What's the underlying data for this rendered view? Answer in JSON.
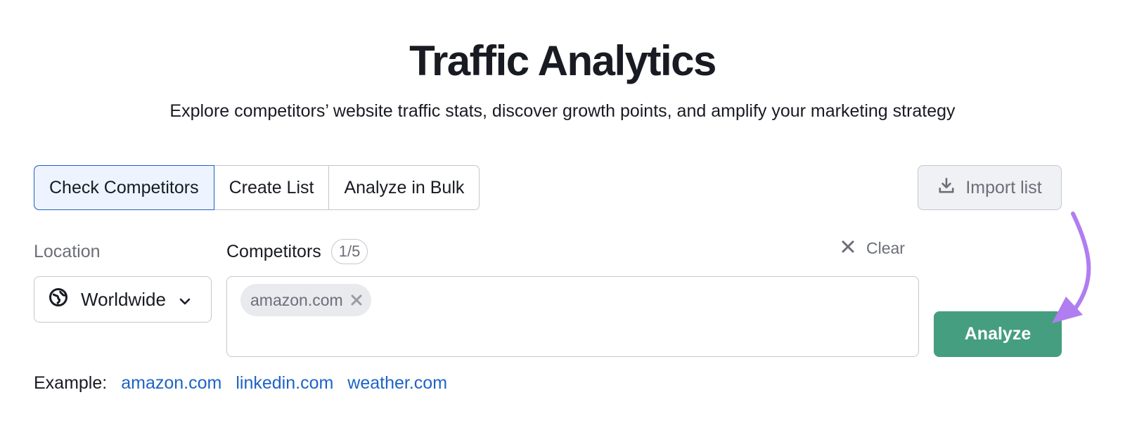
{
  "header": {
    "title": "Traffic Analytics",
    "subtitle": "Explore competitors’ website traffic stats, discover growth points, and amplify your marketing strategy"
  },
  "tabs": [
    {
      "label": "Check Competitors",
      "active": true
    },
    {
      "label": "Create List",
      "active": false
    },
    {
      "label": "Analyze in Bulk",
      "active": false
    }
  ],
  "import_button": {
    "label": "Import list",
    "icon": "download-icon"
  },
  "location": {
    "label": "Location",
    "selected": "Worldwide",
    "icon": "globe-icon"
  },
  "competitors": {
    "label": "Competitors",
    "count": "1/5",
    "clear_label": "Clear",
    "chips": [
      "amazon.com"
    ]
  },
  "analyze_button": {
    "label": "Analyze"
  },
  "examples": {
    "label": "Example:",
    "links": [
      "amazon.com",
      "linkedin.com",
      "weather.com"
    ]
  },
  "colors": {
    "accent_blue": "#1f63c6",
    "analyze_green": "#459e7f",
    "annotation_arrow": "#b07ef0"
  }
}
